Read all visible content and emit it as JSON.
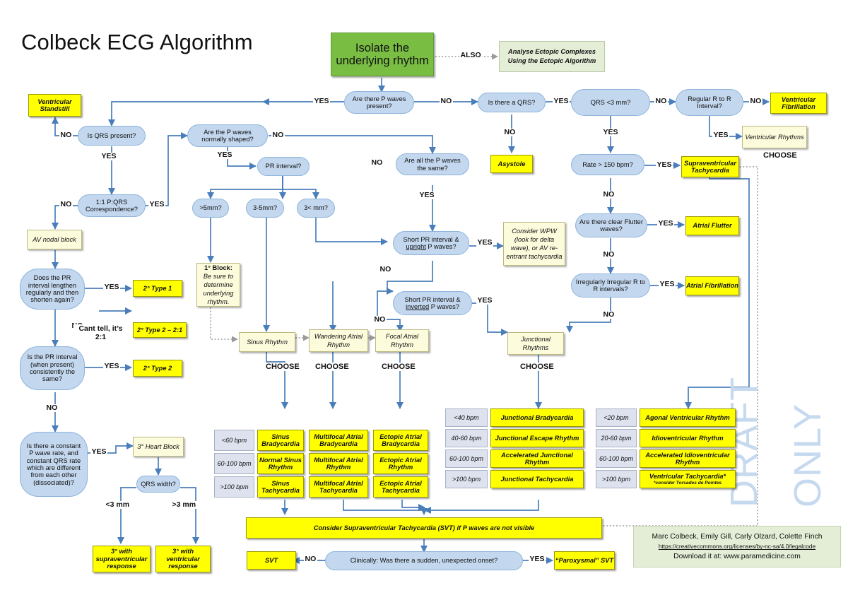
{
  "title": "Colbeck ECG Algorithm",
  "start": {
    "label": "Isolate the underlying rhythm"
  },
  "also": {
    "edge": "ALSO",
    "label": "Analyse Ectopic Complexes Using the Ectopic Algorithm"
  },
  "decisions": {
    "p_waves_present": "Are there P waves present?",
    "is_qrs_present": "Is QRS present?",
    "p_qrs_corr": "1:1 P:QRS Correspondence?",
    "pr_lengthen": "Does the PR interval lengthen regularly and then shorten again?",
    "pr_consistent": "Is the PR interval (when present) consistently the same?",
    "dissociated": "Is there a constant P wave rate, and constant QRS rate which are different from each other (dissociated)?",
    "qrs_width": "QRS width?",
    "p_normal_shape": "Are the P waves normally shaped?",
    "pr_interval": "PR interval?",
    "pr_gt5": ">5mm?",
    "pr_3to5": "3-5mm?",
    "pr_lt3": "3< mm?",
    "p_all_same": "Are all the P waves the same?",
    "short_pr_upright_a": "Short PR interval & ",
    "short_pr_upright_u": "upright",
    "short_pr_upright_b": " P waves?",
    "short_pr_inverted_a": "Short PR interval & ",
    "short_pr_inverted_u": "inverted",
    "short_pr_inverted_b": " P waves?",
    "is_there_qrs": "Is there a QRS?",
    "qrs_lt3mm": "QRS <3 mm?",
    "rate_gt150": "Rate > 150 bpm?",
    "flutter_waves": "Are there clear Flutter waves?",
    "irregular_rr": "Irregularly Irregular R to R intervals?",
    "regular_rr": "Regular R to R Interval?",
    "sudden_onset": "Clinically: Was there a sudden, unexpected onset?"
  },
  "terminals": {
    "ventricular_standstill": "Ventricular Standstill",
    "type1": "2° Type 1",
    "type2_21": "2° Type 2 – 2:1",
    "type2": "2° Type 2",
    "third_supra": "3° with supraventricular response",
    "third_vent": "3° with ventricular response",
    "asystole": "Asystole",
    "svt": "Supraventricular Tachycardia",
    "atrial_flutter": "Atrial Flutter",
    "atrial_fib": "Atrial Fibrillation",
    "vfib": "Ventricular Fibrillation",
    "svt_short": "SVT",
    "paroxysmal_svt": "“Paroxysmal” SVT",
    "consider_svt_banner": "Consider Supraventricular Tachycardia (SVT) if P waves are not visible"
  },
  "creambox": {
    "av_nodal_block": "AV nodal block",
    "third_heart_block": "3° Heart Block",
    "first_block_title": "1° Block:",
    "first_block_body": "Be sure to determine underlying rhythm.",
    "wpw": "Consider WPW (look for delta wave), or AV re-entrant tachycardia",
    "sinus_rhythm": "Sinus Rhythm",
    "wandering_atrial": "Wandering Atrial Rhythm",
    "focal_atrial": "Focal Atrial Rhythm",
    "junctional_rhythms": "Junctional Rhythms",
    "ventricular_rhythms": "Ventricular Rhythms"
  },
  "edge_labels": {
    "yes": "YES",
    "no": "NO",
    "choose": "CHOOSE",
    "cant_tell": "Cant tell, it’s 2:1",
    "qrs_lt3": "<3 mm",
    "qrs_gt3": ">3 mm"
  },
  "tables": {
    "sinus": {
      "rows": [
        {
          "bpm": "<60 bpm",
          "name": "Sinus Bradycardia"
        },
        {
          "bpm": "60-100 bpm",
          "name": "Normal Sinus Rhythm"
        },
        {
          "bpm": ">100 bpm",
          "name": "Sinus Tachycardia"
        }
      ]
    },
    "multifocal": {
      "rows": [
        {
          "name": "Multifocal Atrial Bradycardia"
        },
        {
          "name": "Multifocal Atrial Rhythm"
        },
        {
          "name": "Multifocal Atrial Tachycardia"
        }
      ]
    },
    "ectopic": {
      "rows": [
        {
          "name": "Ectopic Atrial Bradycardia"
        },
        {
          "name": "Ectopic Atrial Rhythm"
        },
        {
          "name": "Ectopic Atrial Tachycardia"
        }
      ]
    },
    "junctional": {
      "rows": [
        {
          "bpm": "<40 bpm",
          "name": "Junctional Bradycardia"
        },
        {
          "bpm": "40-60 bpm",
          "name": "Junctional Escape Rhythm"
        },
        {
          "bpm": "60-100 bpm",
          "name": "Accelerated Junctional Rhythm"
        },
        {
          "bpm": ">100 bpm",
          "name": "Junctional Tachycardia"
        }
      ]
    },
    "ventricular": {
      "rows": [
        {
          "bpm": "<20 bpm",
          "name": "Agonal Ventricular Rhythm"
        },
        {
          "bpm": "20-60 bpm",
          "name": "Idioventricular Rhythm"
        },
        {
          "bpm": "60-100 bpm",
          "name": "Accelerated Idioventricular Rhythm"
        },
        {
          "bpm": ">100 bpm",
          "name": "Ventricular Tachycardia*",
          "note": "*consider Torsades de Pointes"
        }
      ]
    }
  },
  "watermark": {
    "draft": "DRAFT",
    "only": "ONLY"
  },
  "credit": {
    "authors": "Marc Colbeck, Emily Gill, Carly Olzard, Colette Finch",
    "license": "https://creativecommons.org/licenses/by-nc-sa/4.0/legalcode",
    "download": "Download it at: www.paramedicine.com"
  },
  "colors": {
    "start_green": "#79bd43",
    "yellow": "#ffff00",
    "decision_blue": "#c3d7ee",
    "cream": "#fcfbdc",
    "grey": "#dde2ee",
    "note_green": "#e4eed7",
    "wire": "#4a7ebb",
    "watermark": "#c5d9ef"
  }
}
